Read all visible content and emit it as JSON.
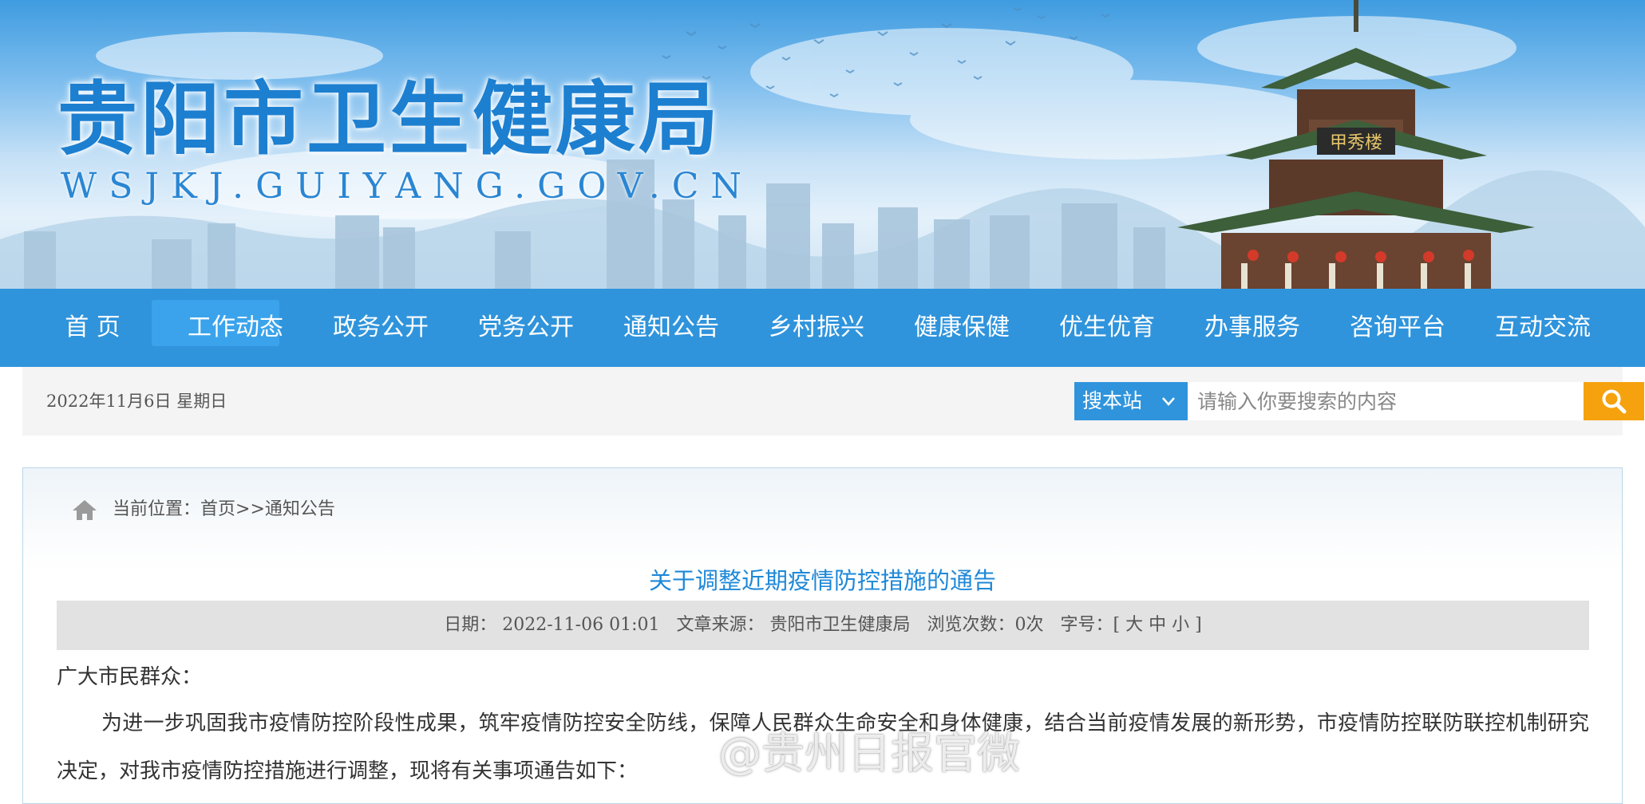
{
  "header": {
    "site_title": "贵阳市卫生健康局",
    "site_url": "WSJKJ.GUIYANG.GOV.CN",
    "tower_plaque": "甲秀楼"
  },
  "nav": {
    "items": [
      "首  页",
      "工作动态",
      "政务公开",
      "党务公开",
      "通知公告",
      "乡村振兴",
      "健康保健",
      "优生优育",
      "办事服务",
      "咨询平台",
      "互动交流"
    ],
    "active_index": 1
  },
  "infobar": {
    "date": "2022年11月6日  星期日",
    "search_scope": "搜本站",
    "search_placeholder": "请输入你要搜索的内容",
    "accent_color": "#2f94dc",
    "search_button_color": "#f5a20e"
  },
  "breadcrumb": {
    "label": "当前位置：",
    "home": "首页",
    "separator": ">>",
    "current": "通知公告"
  },
  "article": {
    "title": "关于调整近期疫情防控措施的通告",
    "meta_date_label": "日期：",
    "meta_date": "2022-11-06 01:01",
    "meta_source_label": "文章来源：",
    "meta_source": "贵阳市卫生健康局",
    "meta_views_label": "浏览次数：",
    "meta_views": "0次",
    "meta_fontsize_label": "字号：",
    "fontsize_open": "[",
    "fontsize_large": "大",
    "fontsize_medium": "中",
    "fontsize_small": "小",
    "fontsize_close": "]",
    "greeting": "广大市民群众：",
    "paragraph": "为进一步巩固我市疫情防控阶段性成果，筑牢疫情防控安全防线，保障人民群众生命安全和身体健康，结合当前疫情发展的新形势，市疫情防控联防联控机制研究决定，对我市疫情防控措施进行调整，现将有关事项通告如下："
  },
  "watermark": {
    "text": "@贵州日报官微"
  }
}
